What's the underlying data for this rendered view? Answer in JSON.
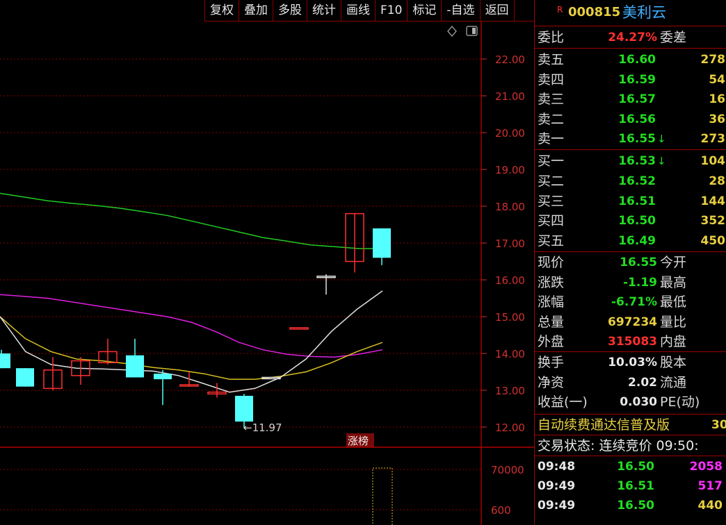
{
  "toolbar": {
    "items": [
      "复权",
      "叠加",
      "多股",
      "统计",
      "画线",
      "F10",
      "标记",
      "-自选",
      "返回"
    ]
  },
  "chart": {
    "price_ticks": [
      "22.00",
      "21.00",
      "20.00",
      "19.00",
      "18.00",
      "17.00",
      "16.00",
      "15.00",
      "14.00",
      "13.00",
      "12.00"
    ],
    "volume_ticks": [
      "70000",
      "600"
    ],
    "low_marker": "←11.97",
    "limit_badge": "涨榜",
    "icons": [
      "diamond-icon",
      "panel-toggle-icon"
    ]
  },
  "chart_data": {
    "type": "candlestick",
    "candles": [
      {
        "o": 14.0,
        "h": 14.1,
        "l": 13.6,
        "c": 13.6,
        "dir": "down"
      },
      {
        "o": 13.6,
        "h": 13.6,
        "l": 13.1,
        "c": 13.1,
        "dir": "down"
      },
      {
        "o": 13.05,
        "h": 13.9,
        "l": 13.0,
        "c": 13.55,
        "dir": "up"
      },
      {
        "o": 13.4,
        "h": 13.9,
        "l": 13.15,
        "c": 13.8,
        "dir": "up"
      },
      {
        "o": 13.75,
        "h": 14.4,
        "l": 13.7,
        "c": 14.05,
        "dir": "up"
      },
      {
        "o": 13.95,
        "h": 14.4,
        "l": 13.35,
        "c": 13.35,
        "dir": "down"
      },
      {
        "o": 13.45,
        "h": 13.55,
        "l": 12.6,
        "c": 13.3,
        "dir": "down"
      },
      {
        "o": 13.15,
        "h": 13.5,
        "l": 13.1,
        "c": 13.12,
        "dir": "flat"
      },
      {
        "o": 12.9,
        "h": 13.2,
        "l": 12.8,
        "c": 12.95,
        "dir": "up"
      },
      {
        "o": 12.85,
        "h": 12.9,
        "l": 11.97,
        "c": 12.15,
        "dir": "down"
      },
      {
        "o": 13.35,
        "h": 13.36,
        "l": 13.34,
        "c": 13.35,
        "dir": "flat"
      },
      {
        "o": 14.7,
        "h": 14.71,
        "l": 14.69,
        "c": 14.7,
        "dir": "up"
      },
      {
        "o": 16.1,
        "h": 16.15,
        "l": 15.6,
        "c": 16.1,
        "dir": "flat"
      },
      {
        "o": 16.5,
        "h": 17.8,
        "l": 16.2,
        "c": 17.8,
        "dir": "up"
      },
      {
        "o": 17.4,
        "h": 17.4,
        "l": 16.4,
        "c": 16.6,
        "dir": "down"
      }
    ],
    "ma_green": [
      18.35,
      18.25,
      18.15,
      18.08,
      18.02,
      17.95,
      17.85,
      17.75,
      17.6,
      17.45,
      17.3,
      17.15,
      17.05,
      16.95,
      16.9,
      16.85,
      16.85
    ],
    "ma_magenta": [
      15.6,
      15.55,
      15.5,
      15.4,
      15.3,
      15.2,
      15.1,
      15.0,
      14.85,
      14.6,
      14.3,
      14.1,
      13.98,
      13.92,
      13.9,
      13.98,
      14.1
    ],
    "ma_yellow": [
      15.0,
      14.4,
      14.05,
      13.85,
      13.8,
      13.72,
      13.62,
      13.55,
      13.45,
      13.3,
      13.3,
      13.38,
      13.5,
      13.75,
      14.05,
      14.3
    ],
    "ma_white": [
      15.0,
      14.05,
      13.7,
      13.6,
      13.58,
      13.55,
      13.52,
      13.4,
      13.18,
      12.95,
      13.05,
      13.35,
      13.85,
      14.6,
      15.2,
      15.7
    ],
    "ylim": [
      11.6,
      22.5
    ]
  },
  "quote": {
    "code": "000815",
    "name": "美利云",
    "r_mark": "R",
    "webi_label": "委比",
    "webi_value": "24.27%",
    "weicha_label": "委差",
    "sells": [
      {
        "label": "卖五",
        "price": "16.60",
        "vol": "278"
      },
      {
        "label": "卖四",
        "price": "16.59",
        "vol": "54"
      },
      {
        "label": "卖三",
        "price": "16.57",
        "vol": "16"
      },
      {
        "label": "卖二",
        "price": "16.56",
        "vol": "36"
      },
      {
        "label": "卖一",
        "price": "16.55",
        "vol": "273",
        "arrow": "↓"
      }
    ],
    "buys": [
      {
        "label": "买一",
        "price": "16.53",
        "vol": "104",
        "arrow": "↓"
      },
      {
        "label": "买二",
        "price": "16.52",
        "vol": "28"
      },
      {
        "label": "买三",
        "price": "16.51",
        "vol": "144"
      },
      {
        "label": "买四",
        "price": "16.50",
        "vol": "352"
      },
      {
        "label": "买五",
        "price": "16.49",
        "vol": "450"
      }
    ],
    "stats": [
      {
        "label": "现价",
        "value": "16.55",
        "color": "green",
        "label2": "今开"
      },
      {
        "label": "涨跌",
        "value": "-1.19",
        "color": "green",
        "label2": "最高"
      },
      {
        "label": "涨幅",
        "value": "-6.71%",
        "color": "green",
        "label2": "最低"
      },
      {
        "label": "总量",
        "value": "697234",
        "color": "yellow",
        "label2": "量比"
      },
      {
        "label": "外盘",
        "value": "315083",
        "color": "red",
        "label2": "内盘"
      }
    ],
    "fund": [
      {
        "label": "换手",
        "value": "10.03%",
        "label2": "股本"
      },
      {
        "label": "净资",
        "value": "2.02",
        "label2": "流通"
      },
      {
        "label": "收益(一)",
        "value": "0.030",
        "label2": "PE(动)"
      }
    ],
    "ad_text": "自动续费通达信普及版",
    "ad_tail": "30",
    "trade_status": "交易状态: 连续竞价 09:50:",
    "ticks": [
      {
        "time": "09:48",
        "price": "16.50",
        "vol": "2058",
        "color": "magenta"
      },
      {
        "time": "09:49",
        "price": "16.51",
        "vol": "517",
        "color": "magenta"
      },
      {
        "time": "09:49",
        "price": "16.50",
        "vol": "440",
        "color": "yellow"
      }
    ]
  },
  "colors": {
    "up": "#ff3030",
    "down": "#54ffff",
    "grid": "#8a0000",
    "green_line": "#22cc22",
    "magenta_line": "#e020e0",
    "yellow_line": "#d8c020",
    "white_line": "#e0e0e0"
  }
}
